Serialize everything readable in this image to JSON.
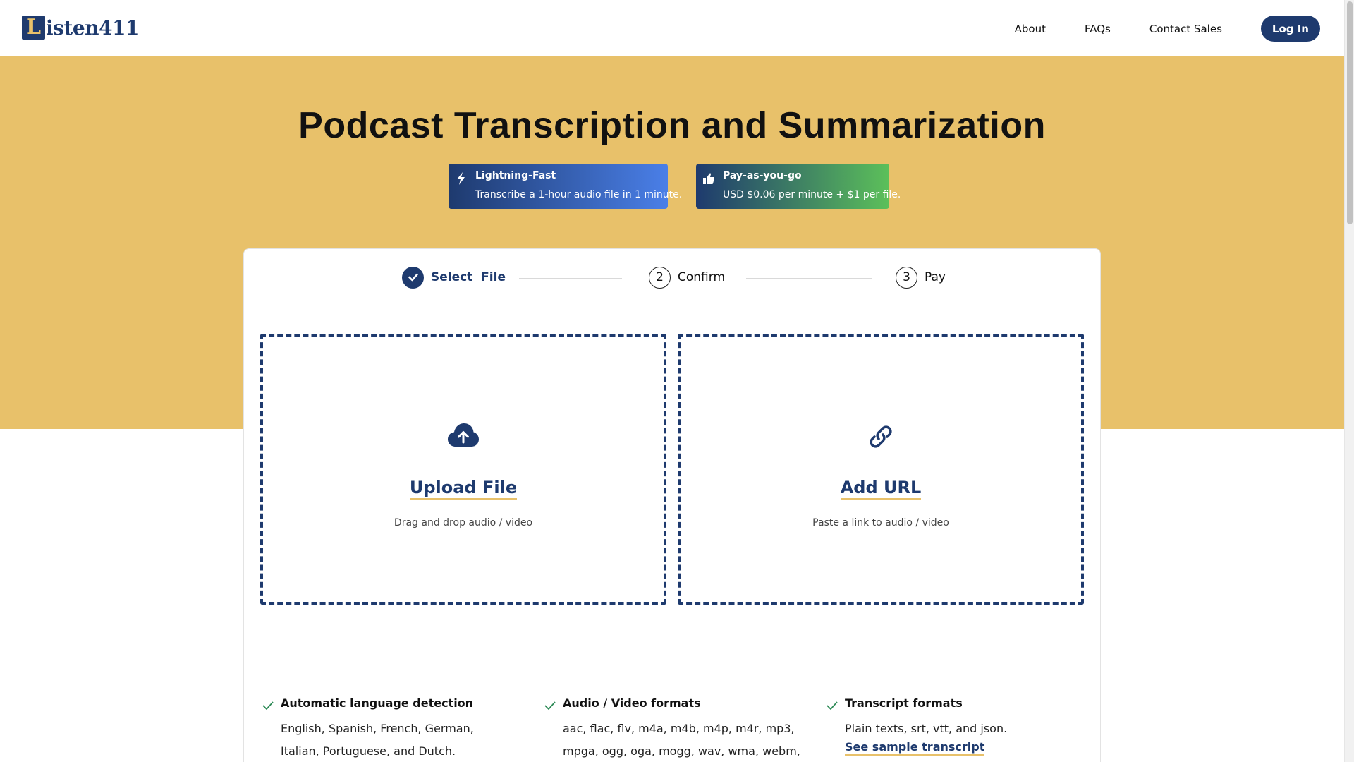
{
  "header": {
    "logo_letter": "L",
    "logo_text": "isten411",
    "nav": [
      "About",
      "FAQs",
      "Contact Sales"
    ],
    "login_label": "Log In"
  },
  "hero": {
    "title": "Podcast Transcription and Summarization",
    "badges": [
      {
        "icon": "lightning-icon",
        "title": "Lightning-Fast",
        "desc": "Transcribe a 1-hour audio file in 1 minute."
      },
      {
        "icon": "thumbs-up-icon",
        "title": "Pay-as-you-go",
        "desc": "USD $0.06 per minute + $1 per file."
      }
    ]
  },
  "stepper": {
    "steps": [
      {
        "number": "",
        "label": "Select  File",
        "state": "done"
      },
      {
        "number": "2",
        "label": "Confirm",
        "state": "todo"
      },
      {
        "number": "3",
        "label": "Pay",
        "state": "todo"
      }
    ]
  },
  "upload": {
    "title": "Upload File",
    "subtitle": "Drag and drop audio / video",
    "icon": "cloud-upload-icon"
  },
  "url": {
    "title": "Add URL",
    "subtitle": "Paste a link to audio / video",
    "icon": "link-icon"
  },
  "features": [
    {
      "title": "Automatic language detection",
      "body": "English, Spanish, French, German, Italian, Portuguese, and Dutch."
    },
    {
      "title": "Audio / Video formats",
      "body": "aac, flac, flv, m4a, m4b, m4p, m4r, mp3, mpga, ogg, oga, mogg, wav, wma, webm, mov,"
    },
    {
      "title": "Transcript formats",
      "body": "Plain texts, srt, vtt, and json.",
      "link": "See sample transcript"
    }
  ],
  "colors": {
    "brand": "#1e3a6e",
    "accent": "#e8c16a"
  }
}
